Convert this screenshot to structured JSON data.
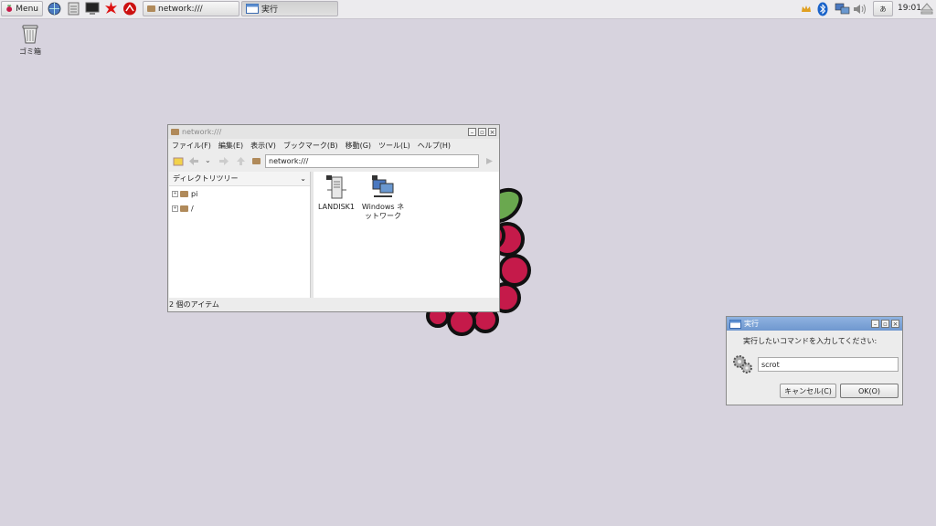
{
  "taskbar": {
    "menu_label": "Menu",
    "tasks": [
      {
        "label": "network:///"
      },
      {
        "label": "実行"
      }
    ],
    "keyboard_indicator": "あ",
    "clock": "19:01"
  },
  "desktop": {
    "trash_label": "ゴミ箱"
  },
  "file_manager": {
    "title": "network:///",
    "menu": [
      "ファイル(F)",
      "編集(E)",
      "表示(V)",
      "ブックマーク(B)",
      "移動(G)",
      "ツール(L)",
      "ヘルプ(H)"
    ],
    "location": "network:///",
    "sidebar_header": "ディレクトリツリー",
    "tree": [
      {
        "label": "pi"
      },
      {
        "label": "/"
      }
    ],
    "items": [
      {
        "label": "LANDISK1"
      },
      {
        "label": "Windows ネットワーク"
      }
    ],
    "status": "2 個のアイテム"
  },
  "run_dialog": {
    "title": "実行",
    "prompt": "実行したいコマンドを入力してください:",
    "command_value": "scrot",
    "cancel_label": "キャンセル(C)",
    "ok_label": "OK(O)"
  }
}
